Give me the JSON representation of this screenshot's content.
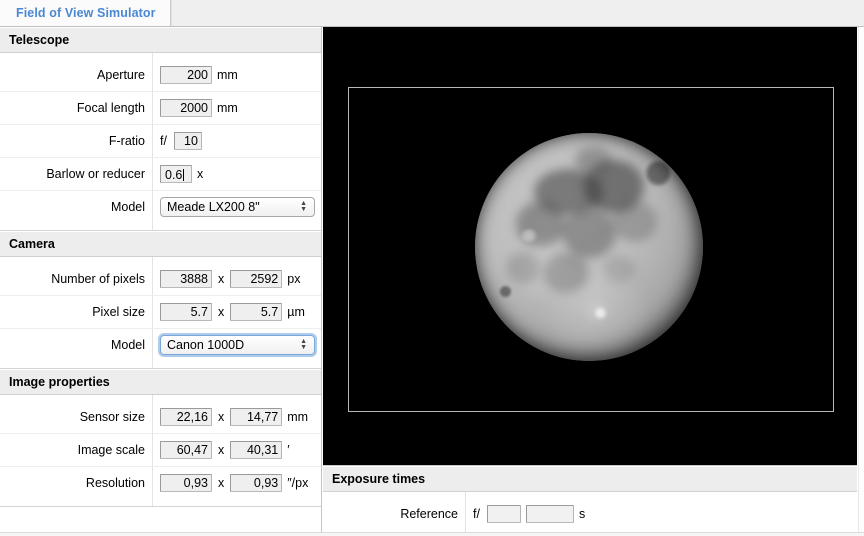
{
  "window": {
    "tab_label": "Field of View Simulator"
  },
  "telescope": {
    "header": "Telescope",
    "rows": [
      {
        "label": "Aperture",
        "value": "200",
        "unit": "mm"
      },
      {
        "label": "Focal length",
        "value": "2000",
        "unit": "mm"
      },
      {
        "label": "F-ratio",
        "prefix": "f/",
        "value": "10",
        "unit": ""
      },
      {
        "label": "Barlow or reducer",
        "value": "0.6",
        "unit": "x"
      }
    ],
    "model_label": "Model",
    "model_value": "Meade LX200 8\""
  },
  "camera": {
    "header": "Camera",
    "pixels_label": "Number of pixels",
    "pixels_w": "3888",
    "pixels_h": "2592",
    "pixels_unit": "px",
    "pixelsize_label": "Pixel size",
    "pixelsize_w": "5.7",
    "pixelsize_h": "5.7",
    "pixelsize_unit": "µm",
    "model_label": "Model",
    "model_value": "Canon 1000D"
  },
  "image_properties": {
    "header": "Image properties",
    "sensor_label": "Sensor size",
    "sensor_w": "22,16",
    "sensor_h": "14,77",
    "sensor_unit": "mm",
    "scale_label": "Image scale",
    "scale_w": "60,47",
    "scale_h": "40,31",
    "scale_unit": "′",
    "resolution_label": "Resolution",
    "resolution_w": "0,93",
    "resolution_h": "0,93",
    "resolution_unit": "″/px"
  },
  "exposure": {
    "header": "Exposure times",
    "reference_label": "Reference",
    "fratio_prefix": "f/",
    "fratio_value": "",
    "seconds_value": "",
    "seconds_unit": "s"
  },
  "preview": {
    "target": "full-moon",
    "background_color": "#000000",
    "fov_frame_color": "#b8b8b8"
  },
  "separators": {
    "times": "x"
  },
  "colors": {
    "tab_text": "#4a88d4",
    "section_header_bg": "#ededed",
    "input_bg": "#efefef",
    "focus_ring": "#6ca3db"
  }
}
